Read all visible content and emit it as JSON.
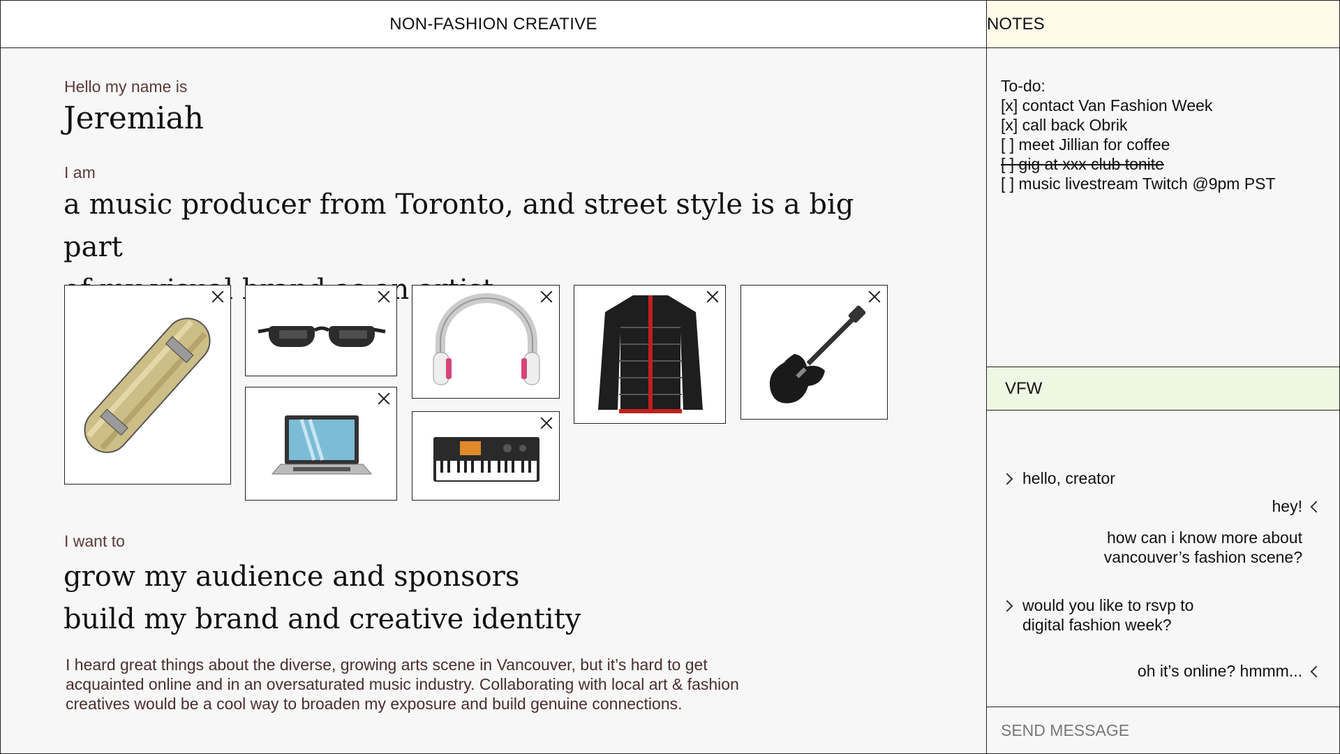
{
  "header": {
    "title": "NON-FASHION CREATIVE"
  },
  "profile": {
    "name_label": "Hello my name is",
    "name": "Jeremiah",
    "iam_label": "I am",
    "iam_line1": "a music producer from Toronto, and street style is a big part",
    "iam_line2": "of my visual brand as an artist",
    "want_label": "I want to",
    "want_line1": "grow my audience and sponsors",
    "want_line2": "build my brand and creative identity",
    "para_line1": "I heard great things about the diverse, growing arts scene in Vancouver, but it’s hard to get",
    "para_line2": "acquainted online and in an oversaturated music industry. Collaborating with local art & fashion",
    "para_line3": "creatives would be a cool way to broaden my exposure and build genuine connections."
  },
  "moodboard": {
    "items": [
      "skateboard",
      "sunglasses",
      "laptop",
      "headphones",
      "keyboard",
      "puffer-jacket",
      "electric-guitar"
    ]
  },
  "notes": {
    "title": "NOTES",
    "todo_title": "To-do:",
    "items": [
      "[x] contact Van Fashion Week",
      "[x] call back Obrik",
      "[ ] meet Jillian for coffee",
      "[ ] gig at xxx club tonite",
      "[ ] music livestream Twitch @9pm PST"
    ]
  },
  "chat": {
    "title": "VFW",
    "messages": [
      {
        "from": "vfw",
        "line1": "hello, creator"
      },
      {
        "from": "me",
        "line1": "hey!"
      },
      {
        "from": "me",
        "line1": "how can i know more about",
        "line2": "vancouver’s fashion scene?"
      },
      {
        "from": "vfw",
        "line1": "would you like to rsvp to",
        "line2": "digital fashion week?"
      },
      {
        "from": "me",
        "line1": "oh it’s online? hmmm..."
      }
    ],
    "send_placeholder": "SEND MESSAGE"
  },
  "colors": {
    "notes_bg": "#fffbea",
    "vfw_bg": "#eef7e1",
    "accent_text": "#5a3a3a"
  }
}
